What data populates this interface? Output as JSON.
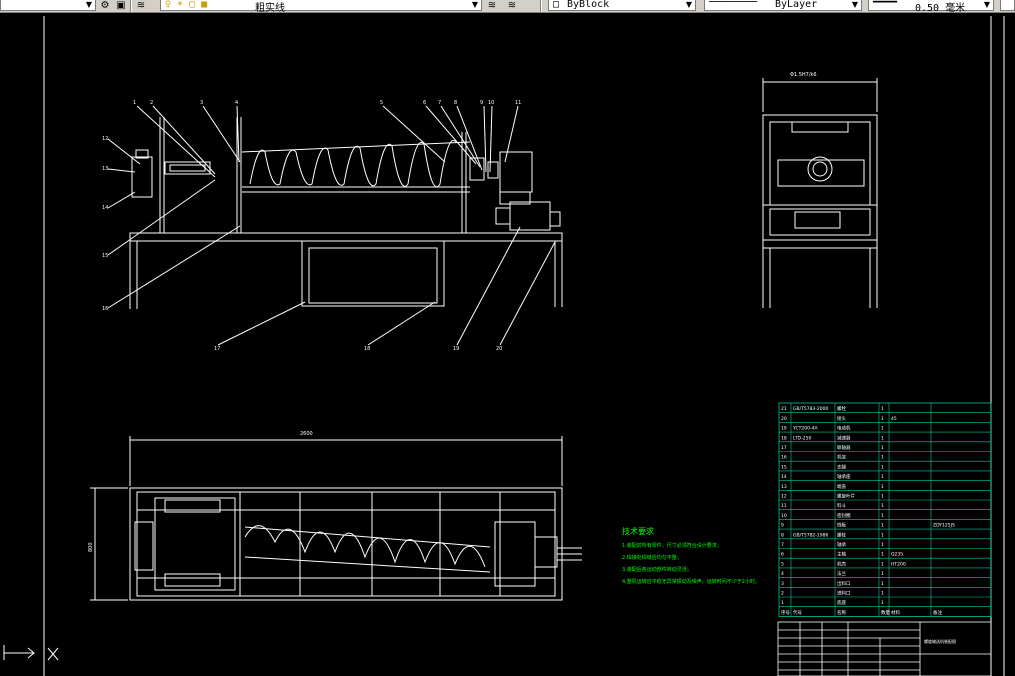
{
  "toolbar": {
    "layer_name": "粗实线",
    "linetype_block": "ByBlock",
    "linetype_layer": "ByLayer",
    "lineweight": "0.50 毫米"
  },
  "drawing": {
    "tech_requirements_title": "技术要求",
    "tech_requirements": [
      "1.装配前所有零件，尺寸必须符合设计要求；",
      "2.焊接处焊缝应均匀平整；",
      "3.装配后各运动部件转动灵活；",
      "4.整机运转应平稳无异常振动及噪声，运转时间不少于2小时。"
    ],
    "top_dims": [
      "Φ1.5H7/k6",
      "K"
    ],
    "plan_dim_length": "2600",
    "plan_dim_width": "800",
    "title_block_name": "螺旋输送机装配图",
    "callouts_top": [
      "1",
      "2",
      "3",
      "4",
      "5",
      "6",
      "7",
      "8",
      "9",
      "10",
      "11"
    ],
    "callouts_left": [
      "12",
      "13",
      "14",
      "15",
      "16"
    ],
    "callouts_bottom": [
      "17",
      "18",
      "19",
      "20"
    ]
  },
  "parts_table": {
    "rows": [
      [
        "21",
        "GB/T5783-2000",
        "螺栓",
        "1",
        "",
        ""
      ],
      [
        "20",
        "",
        "接头",
        "1",
        "45",
        ""
      ],
      [
        "19",
        "YCT200-4A",
        "电动机",
        "1",
        "",
        ""
      ],
      [
        "18",
        "LTD-250",
        "减速器",
        "1",
        "",
        ""
      ],
      [
        "17",
        "",
        "联轴器",
        "1",
        "",
        ""
      ],
      [
        "16",
        "",
        "机架",
        "1",
        "",
        ""
      ],
      [
        "15",
        "",
        "支腿",
        "1",
        "",
        ""
      ],
      [
        "14",
        "",
        "轴承座",
        "1",
        "",
        ""
      ],
      [
        "13",
        "",
        "端盖",
        "1",
        "",
        ""
      ],
      [
        "12",
        "",
        "螺旋叶片",
        "1",
        "",
        ""
      ],
      [
        "11",
        "",
        "料斗",
        "1",
        "",
        ""
      ],
      [
        "10",
        "",
        "密封圈",
        "1",
        "",
        ""
      ],
      [
        "9",
        "",
        "挡板",
        "1",
        "",
        "ZDY125JS"
      ],
      [
        "8",
        "GB/T5782-1986",
        "螺栓",
        "1",
        "",
        ""
      ],
      [
        "7",
        "",
        "轴承",
        "1",
        "",
        ""
      ],
      [
        "6",
        "",
        "主轴",
        "1",
        "Q235",
        ""
      ],
      [
        "5",
        "",
        "机壳",
        "1",
        "HT200",
        ""
      ],
      [
        "4",
        "",
        "法兰",
        "1",
        "",
        ""
      ],
      [
        "3",
        "",
        "出料口",
        "1",
        "",
        ""
      ],
      [
        "2",
        "",
        "进料口",
        "1",
        "",
        ""
      ],
      [
        "1",
        "",
        "底座",
        "1",
        "",
        ""
      ],
      [
        "序号",
        "代号",
        "名称",
        "数量",
        "材料",
        "备注"
      ]
    ]
  },
  "colors": {
    "background": "#000000",
    "outline": "#ffffff",
    "annotation": "#00ff00",
    "table": "#00c8a0",
    "frame": "#ffffff"
  }
}
